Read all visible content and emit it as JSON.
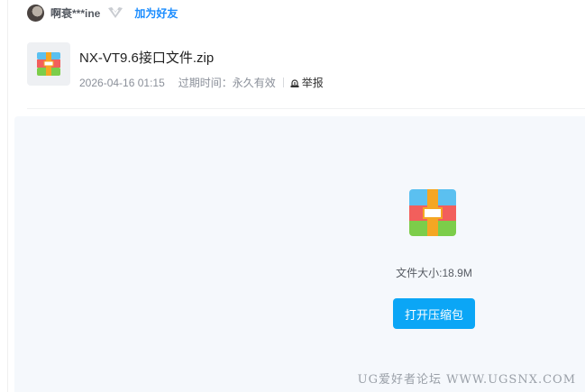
{
  "user": {
    "name": "啊衰***ine",
    "add_friend_label": "加为好友",
    "badge_icon": "v-badge-icon"
  },
  "file": {
    "name": "NX-VT9.6接口文件.zip",
    "date": "2026-04-16 01:15",
    "expire_label": "过期时间：",
    "expire_value": "永久有效",
    "report_label": "举报",
    "thumb_icon": "archive-icon"
  },
  "preview": {
    "size_label": "文件大小:18.9M",
    "open_button": "打开压缩包"
  },
  "watermark": "UG爱好者论坛 WWW.UGSNX.COM",
  "colors": {
    "accent": "#0ba6f6",
    "link": "#1a8cff",
    "preview_bg": "#f5f8fc"
  }
}
